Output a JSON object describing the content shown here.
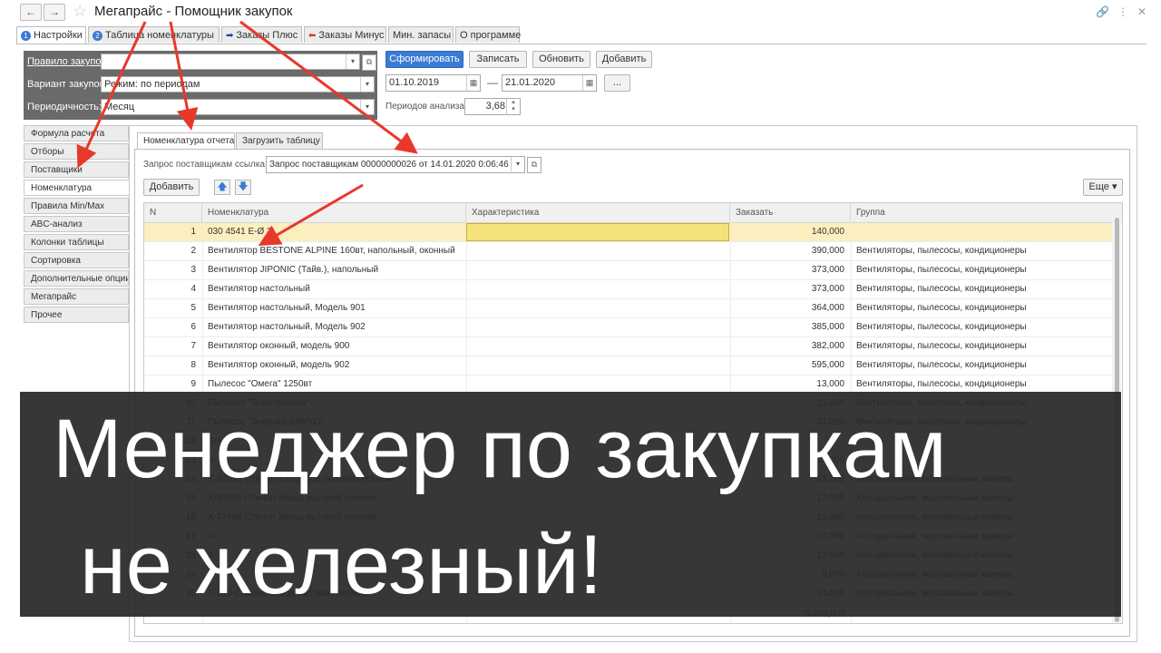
{
  "window": {
    "title": "Мегапрайс - Помощник закупок"
  },
  "tabs": [
    {
      "label": "Настройки",
      "num": "1"
    },
    {
      "label": "Таблица номенклатуры",
      "num": "2"
    },
    {
      "label": "Заказы Плюс"
    },
    {
      "label": "Заказы Минус"
    },
    {
      "label": "Мин. запасы"
    },
    {
      "label": "О программе"
    }
  ],
  "filters": {
    "rule_label": "Правило закупок:",
    "rule_value": "",
    "variant_label": "Вариант закупок:",
    "variant_value": "Режим: по периодам",
    "period_label": "Периодичность:",
    "period_value": "Месяц"
  },
  "toolbar": {
    "form_btn": "Сформировать",
    "save_btn": "Записать",
    "refresh_btn": "Обновить",
    "add_btn": "Добавить",
    "date_from": "01.10.2019",
    "date_sep": "—",
    "date_to": "21.01.2020",
    "dots": "...",
    "periods_label": "Периодов анализа:",
    "periods_value": "3,68"
  },
  "leftnav": [
    "Формула расчета",
    "Отборы",
    "Поставщики",
    "Номенклатура",
    "Правила Min/Max",
    "ABC-анализ",
    "Колонки таблицы",
    "Сортировка",
    "Дополнительные опции",
    "Мегапрайс",
    "Прочее"
  ],
  "inner_tabs": [
    "Номенклатура отчета",
    "Загрузить таблицу"
  ],
  "query": {
    "label": "Запрос поставщикам ссылка:",
    "value": "Запрос поставщикам 00000000026 от 14.01.2020 0:06:46"
  },
  "inner_toolbar": {
    "add_btn": "Добавить",
    "more_btn": "Еще ▾"
  },
  "table": {
    "headers": [
      "N",
      "Номенклатура",
      "Характеристика",
      "Заказать",
      "Группа"
    ],
    "rows": [
      {
        "n": "1",
        "nom": "030 4541 E-Ø 2",
        "char": "",
        "qty": "140,000",
        "grp": ""
      },
      {
        "n": "2",
        "nom": "Вентилятор BESTONE ALPINE 160вт, напольный, оконный",
        "char": "",
        "qty": "390,000",
        "grp": "Вентиляторы, пылесосы, кондиционеры"
      },
      {
        "n": "3",
        "nom": "Вентилятор JIPONIC (Тайв.), напольный",
        "char": "",
        "qty": "373,000",
        "grp": "Вентиляторы, пылесосы, кондиционеры"
      },
      {
        "n": "4",
        "nom": "Вентилятор настольный",
        "char": "",
        "qty": "373,000",
        "grp": "Вентиляторы, пылесосы, кондиционеры"
      },
      {
        "n": "5",
        "nom": "Вентилятор настольный, Модель 901",
        "char": "",
        "qty": "364,000",
        "grp": "Вентиляторы, пылесосы, кондиционеры"
      },
      {
        "n": "6",
        "nom": "Вентилятор настольный, Модель 902",
        "char": "",
        "qty": "385,000",
        "grp": "Вентиляторы, пылесосы, кондиционеры"
      },
      {
        "n": "7",
        "nom": "Вентилятор оконный, модель 900",
        "char": "",
        "qty": "382,000",
        "grp": "Вентиляторы, пылесосы, кондиционеры"
      },
      {
        "n": "8",
        "nom": "Вентилятор оконный, модель 902",
        "char": "",
        "qty": "595,000",
        "grp": "Вентиляторы, пылесосы, кондиционеры"
      },
      {
        "n": "9",
        "nom": "Пылесос \"Омега\" 1250вт",
        "char": "",
        "qty": "13,000",
        "grp": "Вентиляторы, пылесосы, кондиционеры"
      },
      {
        "n": "10",
        "nom": "Пылесос \"Электросила\"",
        "char": "",
        "qty": "11,000",
        "grp": "Вентиляторы, пылесосы, кондиционеры"
      },
      {
        "n": "11",
        "nom": "Пылесос \"Энергия-SANYO\"",
        "char": "",
        "qty": "11,000",
        "grp": "Вентиляторы, пылесосы, кондиционеры"
      },
      {
        "n": "12",
        "nom": "SH...",
        "char": "",
        "qty": "",
        "grp": ""
      },
      {
        "n": "13",
        "nom": "X-16...",
        "char": "",
        "qty": "10,000",
        "grp": ""
      },
      {
        "n": "14",
        "nom": "X-67891 Стинол 235 Завод бытовой техники",
        "char": "",
        "qty": "13,000",
        "grp": "Холодильники, морозильные камеры"
      },
      {
        "n": "15",
        "nom": "X-67891 Стинол Завод бытовой техники",
        "char": "",
        "qty": "17,000",
        "grp": "Холодильники, морозильные камеры"
      },
      {
        "n": "16",
        "nom": "X-77890 Стинол Завод бытовой техники",
        "char": "",
        "qty": "13,000",
        "grp": "Холодильники, морозильные камеры"
      },
      {
        "n": "17",
        "nom": "X-...",
        "char": "",
        "qty": "17,000",
        "grp": "Холодильники, морозильные камеры"
      },
      {
        "n": "18",
        "nom": "X-...",
        "char": "",
        "qty": "17,000",
        "grp": "Холодильники, морозильные камеры"
      },
      {
        "n": "19",
        "nom": "X-...",
        "char": "",
        "qty": "9,000",
        "grp": "Холодильники, морозильные камеры"
      },
      {
        "n": "20",
        "nom": "X-890 Сименс Завод бытовой техники",
        "char": "",
        "qty": "14,000",
        "grp": "Холодильники, морозильные камеры"
      }
    ],
    "total": "5 493,000"
  },
  "overlay": {
    "line1": "Менеджер по закупкам",
    "line2": "не железный!"
  },
  "colors": {
    "accent": "#3a7bd5",
    "selected_row": "#fbefc0",
    "arrow": "#e8382c",
    "overlay_bg": "#2a2a2a"
  }
}
